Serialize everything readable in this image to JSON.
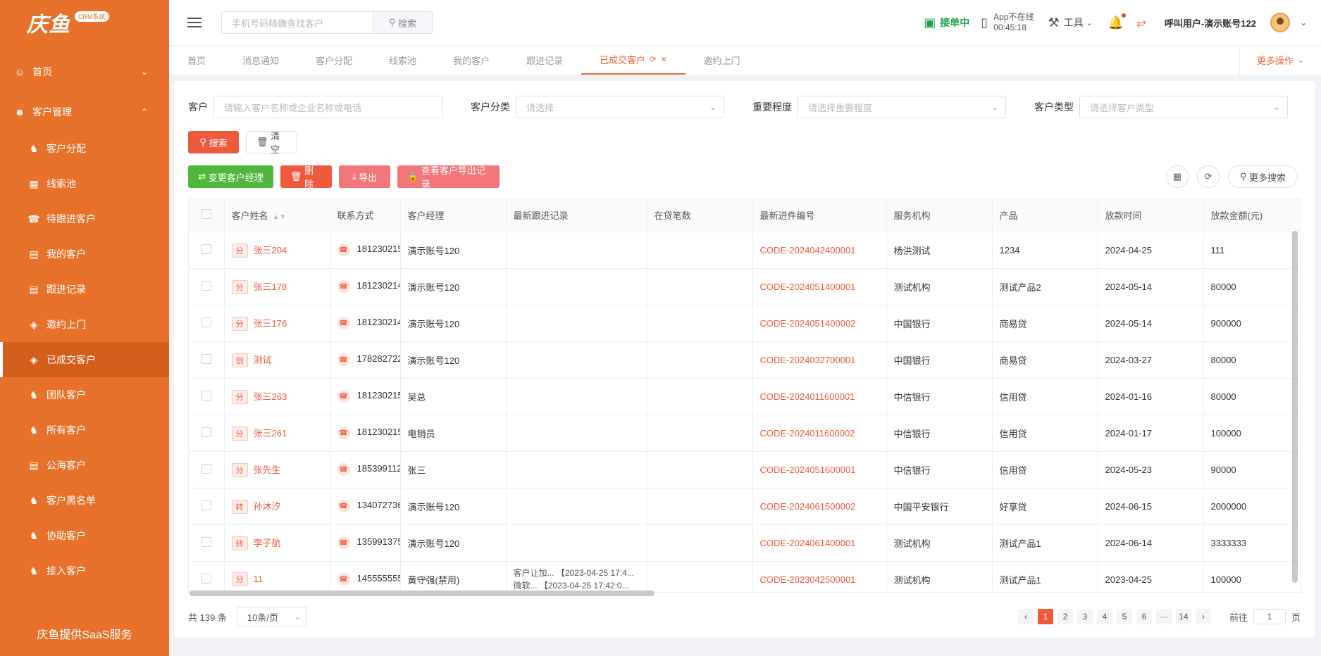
{
  "brand": {
    "logo_text": "庆鱼",
    "badge": "CRM系统",
    "footer": "庆鱼提供SaaS服务",
    "accent": "#e8722c"
  },
  "sidebar": {
    "home": "首页",
    "group": "客户管理",
    "items": [
      {
        "label": "客户分配",
        "icon": "user-assign-icon"
      },
      {
        "label": "线索池",
        "icon": "grid-icon"
      },
      {
        "label": "待跟进客户",
        "icon": "phone-icon"
      },
      {
        "label": "我的客户",
        "icon": "document-icon"
      },
      {
        "label": "跟进记录",
        "icon": "document-icon"
      },
      {
        "label": "邀约上门",
        "icon": "tag-icon"
      },
      {
        "label": "已成交客户",
        "icon": "tag-icon"
      },
      {
        "label": "团队客户",
        "icon": "user-icon"
      },
      {
        "label": "所有客户",
        "icon": "user-icon"
      },
      {
        "label": "公海客户",
        "icon": "document-icon"
      },
      {
        "label": "客户黑名单",
        "icon": "user-icon"
      },
      {
        "label": "协助客户",
        "icon": "user-icon"
      },
      {
        "label": "接入客户",
        "icon": "user-icon"
      }
    ]
  },
  "header": {
    "search_placeholder": "手机号码精确查找客户",
    "search_btn": "搜索",
    "accepting": "接单中",
    "app_status": "App不在线",
    "app_time": "00:45:18",
    "tools": "工具",
    "user": "呼叫用户-演示账号122"
  },
  "tabs": [
    "首页",
    "消息通知",
    "客户分配",
    "线索池",
    "我的客户",
    "跟进记录",
    "已成交客户",
    "邀约上门"
  ],
  "more_ops": "更多操作",
  "filters": {
    "customer_label": "客户",
    "customer_placeholder": "请输入客户名称或企业名称或电话",
    "category_label": "客户分类",
    "category_placeholder": "请选择",
    "importance_label": "重要程度",
    "importance_placeholder": "请选择重要程度",
    "type_label": "客户类型",
    "type_placeholder": "请选择客户类型"
  },
  "buttons": {
    "search": "搜索",
    "clear": "清空",
    "change_manager": "变更客户经理",
    "delete": "删除",
    "export": "导出",
    "export_log": "查看客户导出记录",
    "more_search": "更多搜索"
  },
  "table": {
    "columns": [
      "客户姓名",
      "联系方式",
      "客户经理",
      "最新跟进记录",
      "在贷笔数",
      "最新进件编号",
      "服务机构",
      "产品",
      "放款时间",
      "放款金额(元)"
    ],
    "rows": [
      {
        "tag": "分",
        "name": "张三204",
        "phone": "181230215",
        "manager": "演示账号120",
        "follow1": "",
        "follow2": "",
        "loans": "",
        "code": "CODE-2024042400001",
        "org": "杨洪测试",
        "product": "1234",
        "date": "2024-04-25",
        "amount": "111"
      },
      {
        "tag": "分",
        "name": "张三178",
        "phone": "181230214",
        "manager": "演示账号120",
        "follow1": "",
        "follow2": "",
        "loans": "",
        "code": "CODE-2024051400001",
        "org": "测试机构",
        "product": "测试产品2",
        "date": "2024-05-14",
        "amount": "80000"
      },
      {
        "tag": "分",
        "name": "张三176",
        "phone": "181230214",
        "manager": "演示账号120",
        "follow1": "",
        "follow2": "",
        "loans": "",
        "code": "CODE-2024051400002",
        "org": "中国银行",
        "product": "商易贷",
        "date": "2024-05-14",
        "amount": "900000"
      },
      {
        "tag": "创",
        "name": "测试",
        "phone": "178282722",
        "manager": "演示账号120",
        "follow1": "",
        "follow2": "",
        "loans": "",
        "code": "CODE-2024032700001",
        "org": "中国银行",
        "product": "商易贷",
        "date": "2024-03-27",
        "amount": "80000"
      },
      {
        "tag": "分",
        "name": "张三263",
        "phone": "181230215",
        "manager": "吴总",
        "follow1": "",
        "follow2": "",
        "loans": "",
        "code": "CODE-2024011600001",
        "org": "中信银行",
        "product": "信用贷",
        "date": "2024-01-16",
        "amount": "80000"
      },
      {
        "tag": "分",
        "name": "张三261",
        "phone": "181230215",
        "manager": "电销员",
        "follow1": "",
        "follow2": "",
        "loans": "",
        "code": "CODE-2024011600002",
        "org": "中信银行",
        "product": "信用贷",
        "date": "2024-01-17",
        "amount": "100000"
      },
      {
        "tag": "分",
        "name": "张先生",
        "phone": "185399112",
        "manager": "张三",
        "follow1": "",
        "follow2": "",
        "loans": "",
        "code": "CODE-2024051600001",
        "org": "中信银行",
        "product": "信用贷",
        "date": "2024-05-23",
        "amount": "90000"
      },
      {
        "tag": "转",
        "name": "孙沐汐",
        "phone": "134072736",
        "manager": "演示账号120",
        "follow1": "",
        "follow2": "",
        "loans": "",
        "code": "CODE-2024061500002",
        "org": "中国平安银行",
        "product": "好享贷",
        "date": "2024-06-15",
        "amount": "2000000"
      },
      {
        "tag": "转",
        "name": "李子航",
        "phone": "135991375",
        "manager": "演示账号120",
        "follow1": "",
        "follow2": "",
        "loans": "",
        "code": "CODE-2024061400001",
        "org": "测试机构",
        "product": "测试产品1",
        "date": "2024-06-14",
        "amount": "3333333"
      },
      {
        "tag": "分",
        "name": "11",
        "phone": "145555555",
        "manager": "黄守强(禁用)",
        "follow1": "客户让加... 【2023-04-25 17:4...",
        "follow2": "微软... 【2023-04-25 17:42:0...",
        "loans": "",
        "code": "CODE-2023042500001",
        "org": "测试机构",
        "product": "测试产品1",
        "date": "2023-04-25",
        "amount": "100000"
      }
    ]
  },
  "pagination": {
    "total": "共 139 条",
    "page_size": "10条/页",
    "pages": [
      "1",
      "2",
      "3",
      "4",
      "5",
      "6",
      "···",
      "14"
    ],
    "current": "1",
    "goto_label": "前往",
    "goto_value": "1",
    "goto_suffix": "页"
  }
}
